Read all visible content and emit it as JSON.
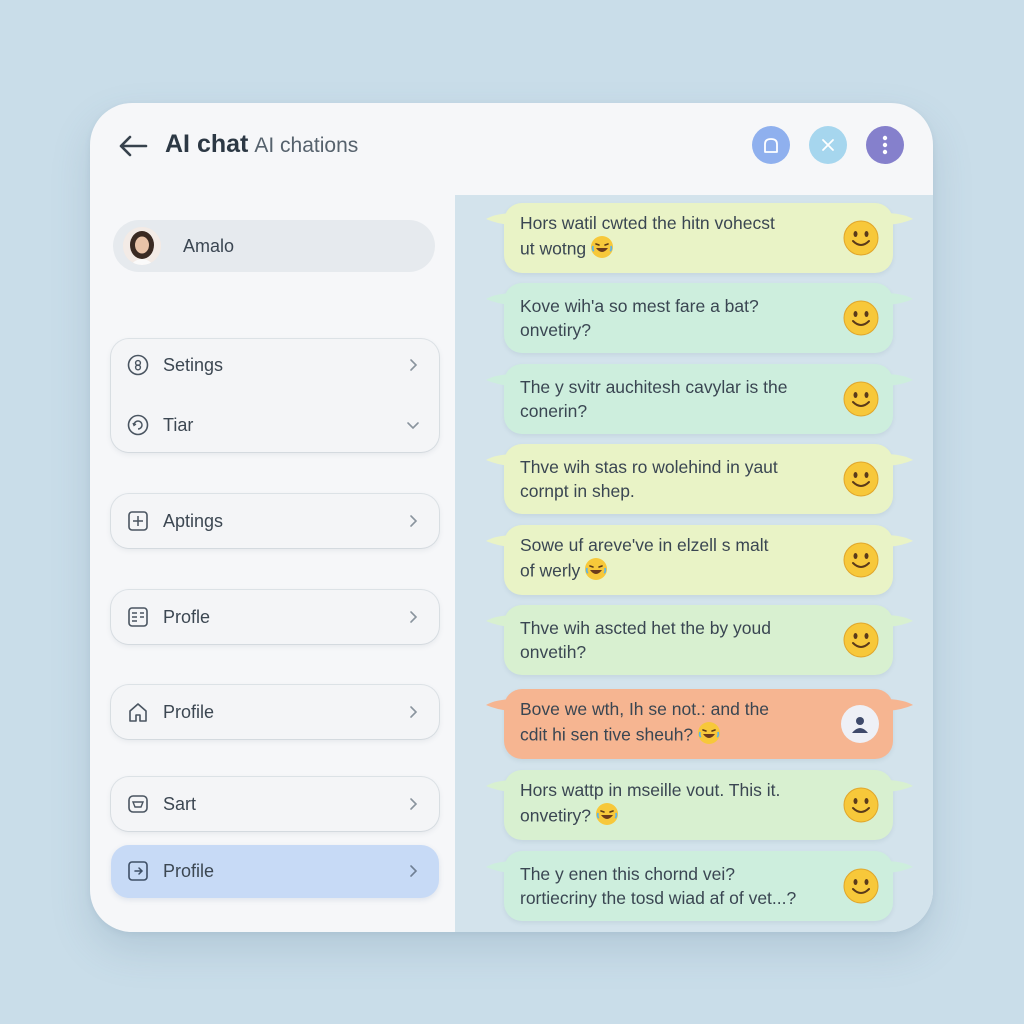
{
  "header": {
    "title": "AI chat",
    "subtitle": "AI chations"
  },
  "sidebar": {
    "profile_name": "Amalo",
    "items": [
      {
        "label": "Setings",
        "icon": "settings-icon",
        "chevron": "right"
      },
      {
        "label": "Tiar",
        "icon": "refresh-icon",
        "chevron": "down"
      },
      {
        "label": "Aptings",
        "icon": "add-square-icon",
        "chevron": "right"
      },
      {
        "label": "Profle",
        "icon": "document-icon",
        "chevron": "right"
      },
      {
        "label": "Profile",
        "icon": "home-icon",
        "chevron": "right"
      },
      {
        "label": "Sart",
        "icon": "cart-icon",
        "chevron": "right"
      },
      {
        "label": "Profile",
        "icon": "export-icon",
        "chevron": "right",
        "active": true
      }
    ]
  },
  "messages": [
    {
      "line1": "Hors watil cwted the hitn vohecst",
      "line2": "ut wotng",
      "inline_emoji": "laughing",
      "right": "smiley",
      "color": "#e9f3c6"
    },
    {
      "line1": "Kove wih'a so mest fare a bat?",
      "line2": "onvetiry?",
      "inline_emoji": "",
      "right": "smiley",
      "color": "#cdeedd"
    },
    {
      "line1": "The y svitr auchitesh cavylar is the",
      "line2": "conerin?",
      "inline_emoji": "",
      "right": "smiley",
      "color": "#cdeedd"
    },
    {
      "line1": "Thve wih stas ro wolehind in yaut",
      "line2": "cornpt in shep.",
      "inline_emoji": "",
      "right": "smiley",
      "color": "#e9f3c6"
    },
    {
      "line1": "Sowe uf areve've in elzell s malt",
      "line2": "of werly",
      "inline_emoji": "laughing",
      "right": "smiley",
      "color": "#e9f3c6"
    },
    {
      "line1": "Thve wih ascted het the by youd",
      "line2": "onvetih?",
      "inline_emoji": "",
      "right": "smiley",
      "color": "#d8f0d0"
    },
    {
      "line1": "Bove we wth, Ih se not.: and the",
      "line2": "cdit hi sen tive sheuh?",
      "inline_emoji": "laughing",
      "right": "user",
      "color": "#f6b591"
    },
    {
      "line1": "Hors wattp in mseille vout. This it.",
      "line2": "onvetiry?",
      "inline_emoji": "laughing",
      "right": "smiley",
      "color": "#d8f0d0"
    },
    {
      "line1": "The y enen this chornd vei?",
      "line2": "rortiecriny the tosd wiad af of vet...?",
      "inline_emoji": "",
      "right": "smiley",
      "color": "#cdeedd"
    }
  ],
  "colors": {
    "background": "#c9dde9",
    "panel": "#d3e3ec",
    "accent_active": "#c7daf6",
    "user_bubble": "#f6b591"
  }
}
